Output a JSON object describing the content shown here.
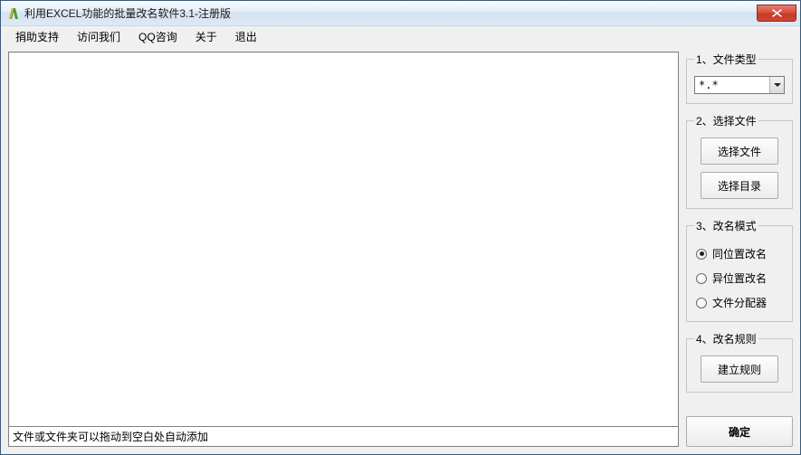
{
  "window": {
    "title": "利用EXCEL功能的批量改名软件3.1-注册版"
  },
  "menu": {
    "items": [
      "捐助支持",
      "访问我们",
      "QQ咨询",
      "关于",
      "退出"
    ]
  },
  "left": {
    "hint": "文件或文件夹可以拖动到空白处自动添加"
  },
  "panel": {
    "g1": {
      "legend": "1、文件类型",
      "combo_value": "*.*"
    },
    "g2": {
      "legend": "2、选择文件",
      "btn_file": "选择文件",
      "btn_dir": "选择目录"
    },
    "g3": {
      "legend": "3、改名模式",
      "r1": "同位置改名",
      "r2": "异位置改名",
      "r3": "文件分配器",
      "selected": "r1"
    },
    "g4": {
      "legend": "4、改名规则",
      "btn_rule": "建立规则"
    },
    "ok": "确定"
  }
}
